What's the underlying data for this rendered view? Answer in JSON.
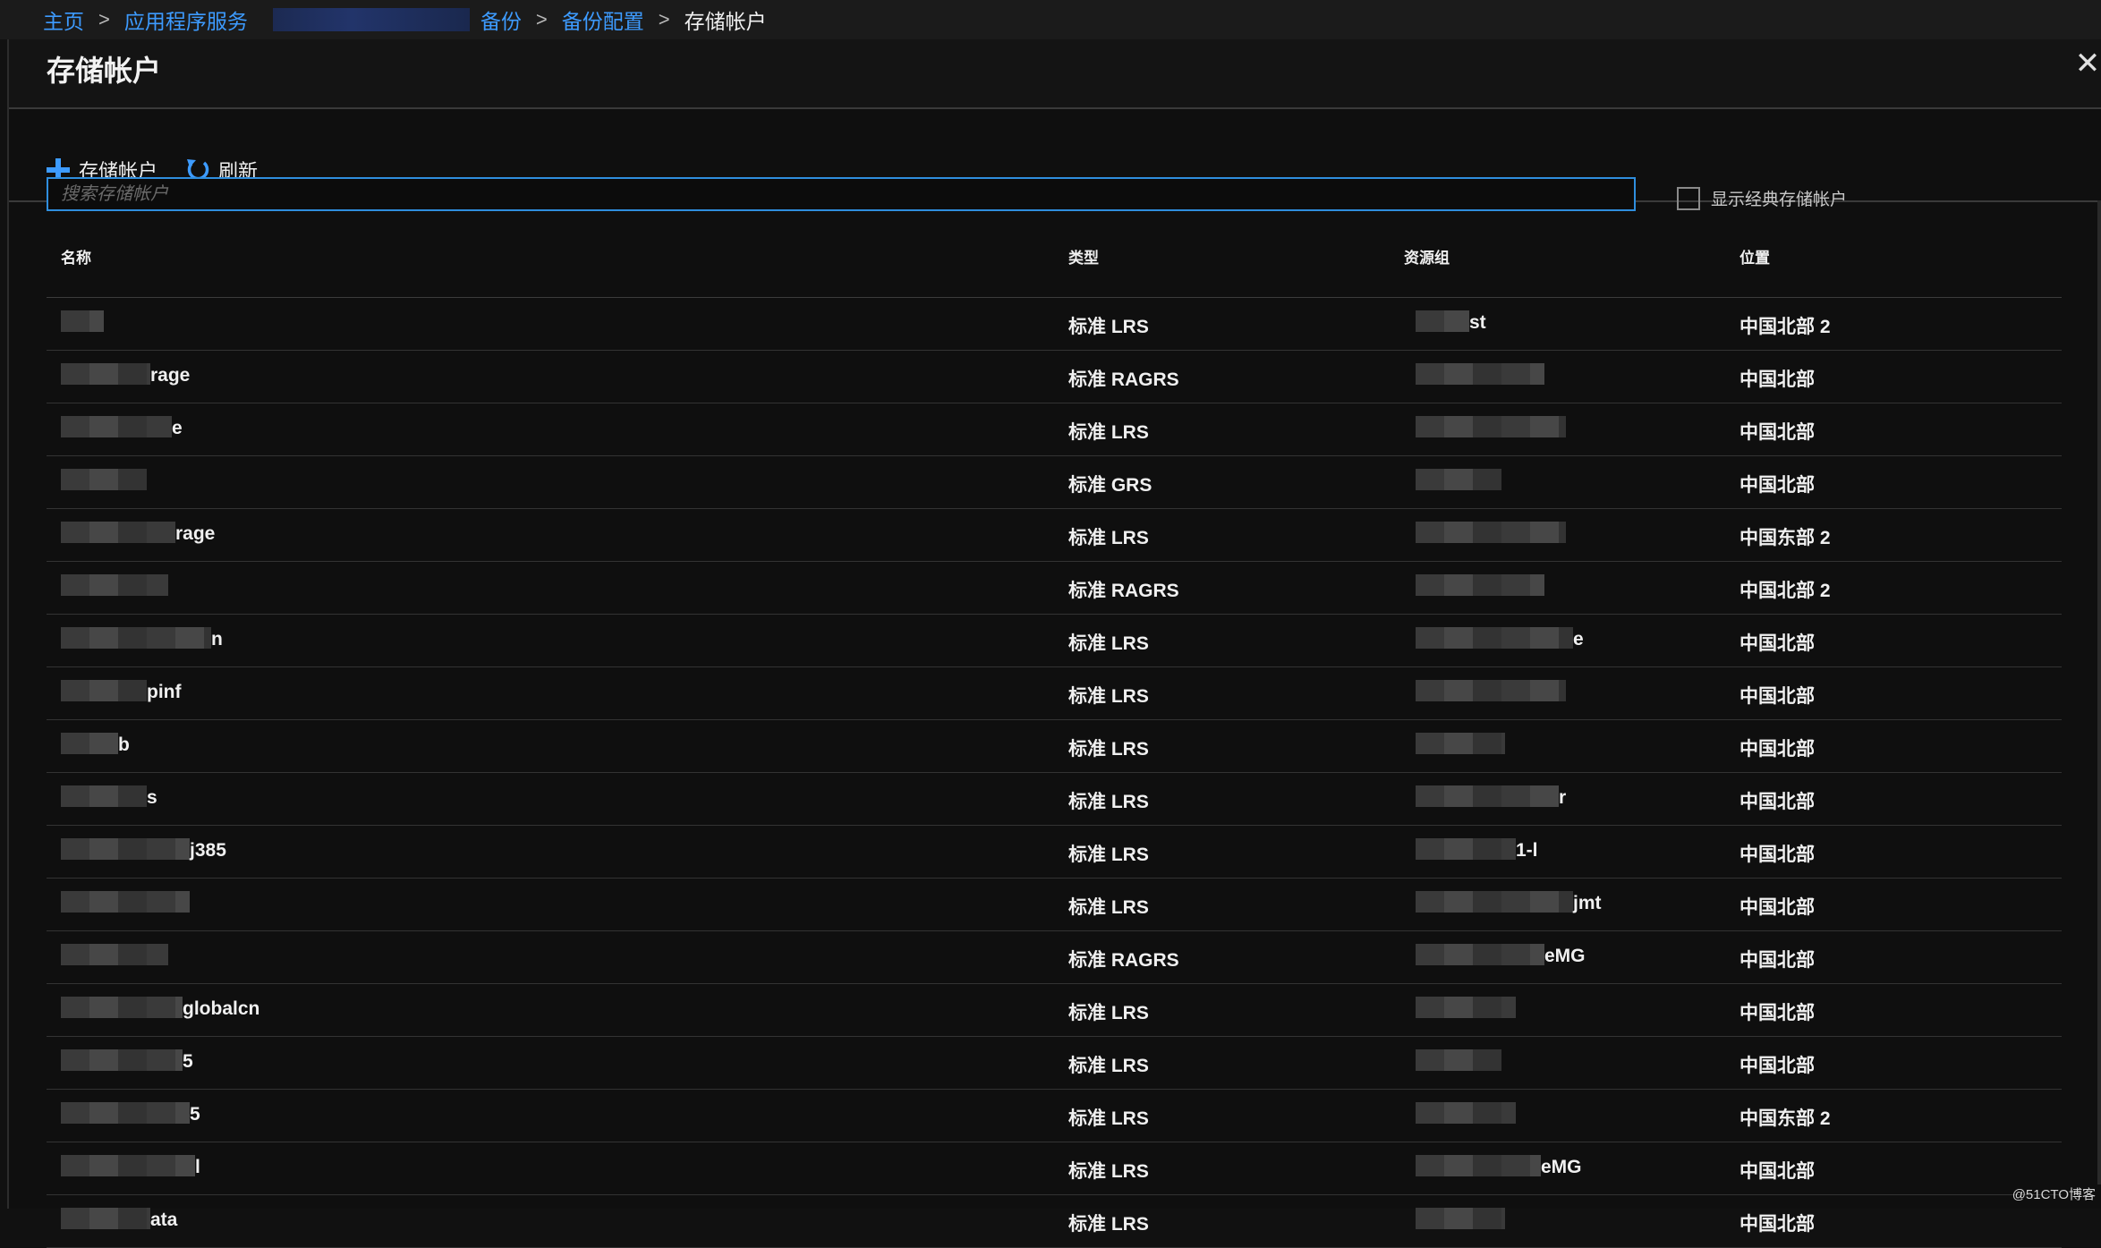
{
  "breadcrumb": {
    "home": "主页",
    "app_services": "应用程序服务",
    "backup": "备份",
    "backup_config": "备份配置",
    "current": "存储帐户",
    "separator": ">"
  },
  "panel": {
    "title": "存储帐户",
    "close_glyph": "✕"
  },
  "toolbar": {
    "add_label": "存储帐户",
    "refresh_label": "刷新"
  },
  "search": {
    "placeholder": "搜索存储帐户",
    "value": ""
  },
  "classic_checkbox": {
    "label": "显示经典存储帐户",
    "checked": false
  },
  "table": {
    "headers": {
      "name": "名称",
      "type": "类型",
      "resource_group": "资源组",
      "location": "位置"
    },
    "rows": [
      {
        "name": "",
        "type": "标准 LRS",
        "rg": "st",
        "loc": "中国北部 2"
      },
      {
        "name": "rage",
        "type": "标准 RAGRS",
        "rg": "",
        "loc": "中国北部"
      },
      {
        "name": "e",
        "type": "标准 LRS",
        "rg": "",
        "loc": "中国北部"
      },
      {
        "name": "",
        "type": "标准 GRS",
        "rg": "",
        "loc": "中国北部"
      },
      {
        "name": "rage",
        "type": "标准 LRS",
        "rg": "",
        "loc": "中国东部 2"
      },
      {
        "name": "",
        "type": "标准 RAGRS",
        "rg": "",
        "loc": "中国北部 2"
      },
      {
        "name": "n",
        "type": "标准 LRS",
        "rg": "e",
        "loc": "中国北部"
      },
      {
        "name": "pinf",
        "type": "标准 LRS",
        "rg": "",
        "loc": "中国北部"
      },
      {
        "name": "b",
        "type": "标准 LRS",
        "rg": "",
        "loc": "中国北部"
      },
      {
        "name": "s",
        "type": "标准 LRS",
        "rg": "r",
        "loc": "中国北部"
      },
      {
        "name": "j385",
        "type": "标准 LRS",
        "rg": "1-l",
        "loc": "中国北部"
      },
      {
        "name": "",
        "type": "标准 LRS",
        "rg": "jmt",
        "loc": "中国北部"
      },
      {
        "name": "",
        "type": "标准 RAGRS",
        "rg": "eMG",
        "loc": "中国北部"
      },
      {
        "name": "globalcn",
        "type": "标准 LRS",
        "rg": "",
        "loc": "中国北部"
      },
      {
        "name": "5",
        "type": "标准 LRS",
        "rg": "",
        "loc": "中国北部"
      },
      {
        "name": "5",
        "type": "标准 LRS",
        "rg": "",
        "loc": "中国东部 2"
      },
      {
        "name": "l",
        "type": "标准 LRS",
        "rg": "eMG",
        "loc": "中国北部"
      },
      {
        "name": "ata",
        "type": "标准 LRS",
        "rg": "",
        "loc": "中国北部"
      }
    ]
  },
  "watermark": "@51CTO博客",
  "colors": {
    "link": "#3d9bff",
    "accent_blue": "#2f8ede",
    "background": "#111111"
  },
  "icons": {
    "add": "plus-icon",
    "refresh": "refresh-icon",
    "close": "close-icon"
  }
}
